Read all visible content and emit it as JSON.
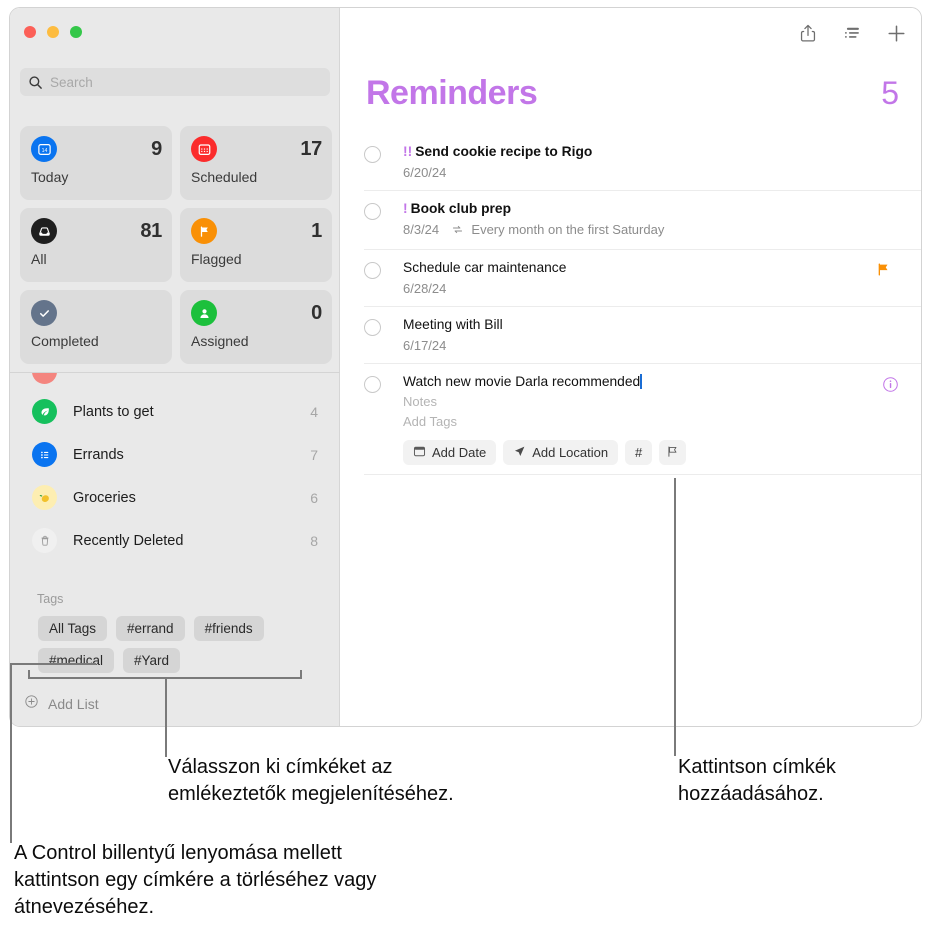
{
  "window": {
    "traffic_lights": [
      "close",
      "minimize",
      "zoom"
    ],
    "colors": {
      "accent": "#c276e8",
      "flag": "#f99006",
      "close": "#fc6058",
      "minimize": "#fdbc40",
      "zoom": "#34c749"
    }
  },
  "sidebar": {
    "search": {
      "placeholder": "Search",
      "value": "",
      "icon": "search-icon"
    },
    "tiles": [
      {
        "id": "today",
        "label": "Today",
        "count": "9",
        "icon": "calendar-day-icon"
      },
      {
        "id": "scheduled",
        "label": "Scheduled",
        "count": "17",
        "icon": "calendar-icon"
      },
      {
        "id": "all",
        "label": "All",
        "count": "81",
        "icon": "inbox-tray-icon"
      },
      {
        "id": "flagged",
        "label": "Flagged",
        "count": "1",
        "icon": "flag-icon"
      },
      {
        "id": "completed",
        "label": "Completed",
        "count": "",
        "icon": "checkmark-circle-icon"
      },
      {
        "id": "assigned",
        "label": "Assigned",
        "count": "0",
        "icon": "person-icon"
      }
    ],
    "lists": [
      {
        "name": "Plants to get",
        "count": "4",
        "icon": "leaf-icon"
      },
      {
        "name": "Errands",
        "count": "7",
        "icon": "list-bullet-icon"
      },
      {
        "name": "Groceries",
        "count": "6",
        "icon": "lemon-icon"
      },
      {
        "name": "Recently Deleted",
        "count": "8",
        "icon": "trash-icon"
      }
    ],
    "tags_header": "Tags",
    "tags": [
      "All Tags",
      "#errand",
      "#friends",
      "#medical",
      "#Yard"
    ],
    "add_list": {
      "label": "Add List",
      "icon": "plus-circle-icon"
    }
  },
  "main": {
    "toolbar": [
      {
        "id": "share",
        "label": "Share",
        "icon": "share-icon"
      },
      {
        "id": "view",
        "label": "View",
        "icon": "list-view-icon"
      },
      {
        "id": "add",
        "label": "Add",
        "icon": "plus-icon"
      }
    ],
    "title": "Reminders",
    "count": "5",
    "reminders": [
      {
        "priority": "!!",
        "title": "Send cookie recipe to Rigo",
        "meta": "6/20/24",
        "repeat": "",
        "flagged": false,
        "selected": false
      },
      {
        "priority": "!",
        "title": "Book club prep",
        "meta": "8/3/24",
        "repeat": "Every month on the first Saturday",
        "flagged": false,
        "selected": false
      },
      {
        "priority": "",
        "title": "Schedule car maintenance",
        "meta": "6/28/24",
        "repeat": "",
        "flagged": true,
        "selected": false
      },
      {
        "priority": "",
        "title": "Meeting with Bill",
        "meta": "6/17/24",
        "repeat": "",
        "flagged": false,
        "selected": false
      },
      {
        "priority": "",
        "title": "Watch new movie Darla recommended",
        "notes_placeholder": "Notes",
        "tags_placeholder": "Add Tags",
        "flagged": false,
        "selected": true,
        "actions": [
          {
            "id": "add-date",
            "label": "Add Date",
            "icon": "calendar-small-icon"
          },
          {
            "id": "add-location",
            "label": "Add Location",
            "icon": "location-arrow-icon"
          },
          {
            "id": "add-tag",
            "label": "#",
            "icon": "hash-icon"
          },
          {
            "id": "add-flag",
            "label": "",
            "icon": "flag-outline-icon"
          }
        ],
        "info_icon": "info-circle-icon"
      }
    ]
  },
  "callouts": [
    {
      "id": "select-tags",
      "text": "Válasszon ki címkéket az emlékeztetők megjelenítéséhez."
    },
    {
      "id": "add-tags",
      "text": "Kattintson címkék hozzáadásához."
    },
    {
      "id": "control-click",
      "text": "A Control billentyű lenyomása mellett kattintson egy címkére a törléséhez vagy átnevezéséhez."
    }
  ]
}
